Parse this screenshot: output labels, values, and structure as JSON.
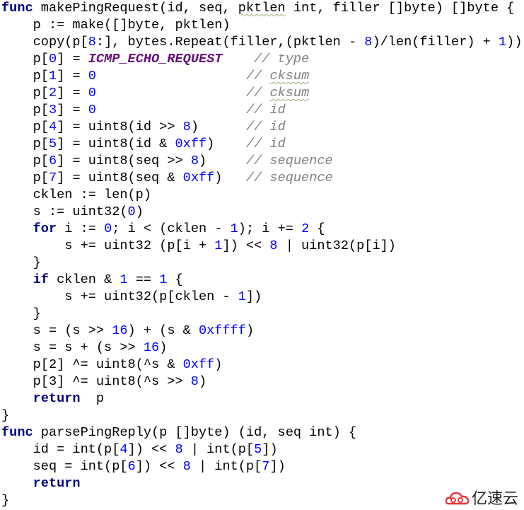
{
  "code": {
    "lines": [
      [
        [
          "func",
          "k"
        ],
        [
          " makePingRequest(id, seq, ",
          "p"
        ],
        [
          "pktlen",
          "pw"
        ],
        [
          " int, filler []byte) []byte {",
          "p"
        ]
      ],
      [
        [
          "    p := make([]byte, pktlen)",
          "p"
        ]
      ],
      [
        [
          "    copy(p[",
          "p"
        ],
        [
          "8",
          "n"
        ],
        [
          ":], bytes.Repeat(filler,(pktlen - ",
          "p"
        ],
        [
          "8",
          "n"
        ],
        [
          ")/len(filler) + ",
          "p"
        ],
        [
          "1",
          "n"
        ],
        [
          "))",
          "p"
        ]
      ],
      [
        [
          "    p[",
          "p"
        ],
        [
          "0",
          "n"
        ],
        [
          "] = ",
          "p"
        ],
        [
          "ICMP_ECHO_REQUEST",
          "c"
        ],
        [
          "    ",
          "p"
        ],
        [
          "// type",
          "m"
        ]
      ],
      [
        [
          "    p[",
          "p"
        ],
        [
          "1",
          "n"
        ],
        [
          "] = ",
          "p"
        ],
        [
          "0",
          "n"
        ],
        [
          "                   ",
          "p"
        ],
        [
          "// ",
          "m"
        ],
        [
          "cksum",
          "mw"
        ]
      ],
      [
        [
          "    p[",
          "p"
        ],
        [
          "2",
          "n"
        ],
        [
          "] = ",
          "p"
        ],
        [
          "0",
          "n"
        ],
        [
          "                   ",
          "p"
        ],
        [
          "// ",
          "m"
        ],
        [
          "cksum",
          "mw"
        ]
      ],
      [
        [
          "    p[",
          "p"
        ],
        [
          "3",
          "n"
        ],
        [
          "] = ",
          "p"
        ],
        [
          "0",
          "n"
        ],
        [
          "                   ",
          "p"
        ],
        [
          "// id",
          "m"
        ]
      ],
      [
        [
          "    p[",
          "p"
        ],
        [
          "4",
          "n"
        ],
        [
          "] = uint8(id >> ",
          "p"
        ],
        [
          "8",
          "n"
        ],
        [
          ")      ",
          "p"
        ],
        [
          "// id",
          "m"
        ]
      ],
      [
        [
          "    p[",
          "p"
        ],
        [
          "5",
          "n"
        ],
        [
          "] = uint8(id & ",
          "p"
        ],
        [
          "0xff",
          "n"
        ],
        [
          ")    ",
          "p"
        ],
        [
          "// id",
          "m"
        ]
      ],
      [
        [
          "    p[",
          "p"
        ],
        [
          "6",
          "n"
        ],
        [
          "] = uint8(seq >> ",
          "p"
        ],
        [
          "8",
          "n"
        ],
        [
          ")     ",
          "p"
        ],
        [
          "// sequence",
          "m"
        ]
      ],
      [
        [
          "    p[",
          "p"
        ],
        [
          "7",
          "n"
        ],
        [
          "] = uint8(seq & ",
          "p"
        ],
        [
          "0xff",
          "n"
        ],
        [
          ")   ",
          "p"
        ],
        [
          "// sequence",
          "m"
        ]
      ],
      [
        [
          "    cklen := len(p)",
          "p"
        ]
      ],
      [
        [
          "    s := uint32(",
          "p"
        ],
        [
          "0",
          "n"
        ],
        [
          ")",
          "p"
        ]
      ],
      [
        [
          "    ",
          "p"
        ],
        [
          "for",
          "k"
        ],
        [
          " i := ",
          "p"
        ],
        [
          "0",
          "n"
        ],
        [
          "; i < (cklen - ",
          "p"
        ],
        [
          "1",
          "n"
        ],
        [
          "); i += ",
          "p"
        ],
        [
          "2",
          "n"
        ],
        [
          " {",
          "p"
        ]
      ],
      [
        [
          "        s += uint32 (p[i + ",
          "p"
        ],
        [
          "1",
          "n"
        ],
        [
          "]) << ",
          "p"
        ],
        [
          "8",
          "n"
        ],
        [
          " | uint32(p[i])",
          "p"
        ]
      ],
      [
        [
          "    }",
          "p"
        ]
      ],
      [
        [
          "    ",
          "p"
        ],
        [
          "if",
          "k"
        ],
        [
          " cklen & ",
          "p"
        ],
        [
          "1",
          "n"
        ],
        [
          " == ",
          "p"
        ],
        [
          "1",
          "n"
        ],
        [
          " {",
          "p"
        ]
      ],
      [
        [
          "        s += uint32(p[cklen - ",
          "p"
        ],
        [
          "1",
          "n"
        ],
        [
          "])",
          "p"
        ]
      ],
      [
        [
          "    }",
          "p"
        ]
      ],
      [
        [
          "    s = (s >> ",
          "p"
        ],
        [
          "16",
          "n"
        ],
        [
          ") + (s & ",
          "p"
        ],
        [
          "0xffff",
          "n"
        ],
        [
          ")",
          "p"
        ]
      ],
      [
        [
          "    s = s + (s >> ",
          "p"
        ],
        [
          "16",
          "n"
        ],
        [
          ")",
          "p"
        ]
      ],
      [
        [
          "    p[2] ^= uint8(^s & ",
          "p"
        ],
        [
          "0xff",
          "n"
        ],
        [
          ")",
          "p"
        ]
      ],
      [
        [
          "    p[3] ^= uint8(^s >> ",
          "p"
        ],
        [
          "8",
          "n"
        ],
        [
          ")",
          "p"
        ]
      ],
      [
        [
          "    ",
          "p"
        ],
        [
          "return",
          "k"
        ],
        [
          "  p",
          "p"
        ]
      ],
      [
        [
          "}",
          "p"
        ]
      ],
      [
        [
          "func",
          "k"
        ],
        [
          " parsePingReply(p []byte) (id, seq int) {",
          "p"
        ]
      ],
      [
        [
          "    id = int(p[",
          "p"
        ],
        [
          "4",
          "n"
        ],
        [
          "]) << ",
          "p"
        ],
        [
          "8",
          "n"
        ],
        [
          " | int(p[",
          "p"
        ],
        [
          "5",
          "n"
        ],
        [
          "])",
          "p"
        ]
      ],
      [
        [
          "    seq = int(p[",
          "p"
        ],
        [
          "6",
          "n"
        ],
        [
          "]) << ",
          "p"
        ],
        [
          "8",
          "n"
        ],
        [
          " | int(p[",
          "p"
        ],
        [
          "7",
          "n"
        ],
        [
          "])",
          "p"
        ]
      ],
      [
        [
          "    ",
          "p"
        ],
        [
          "return",
          "k"
        ]
      ],
      [
        [
          "}",
          "p"
        ]
      ]
    ]
  },
  "watermark": {
    "text": "亿速云",
    "color": "#e4393c",
    "icon": "cloud-logo-icon"
  }
}
